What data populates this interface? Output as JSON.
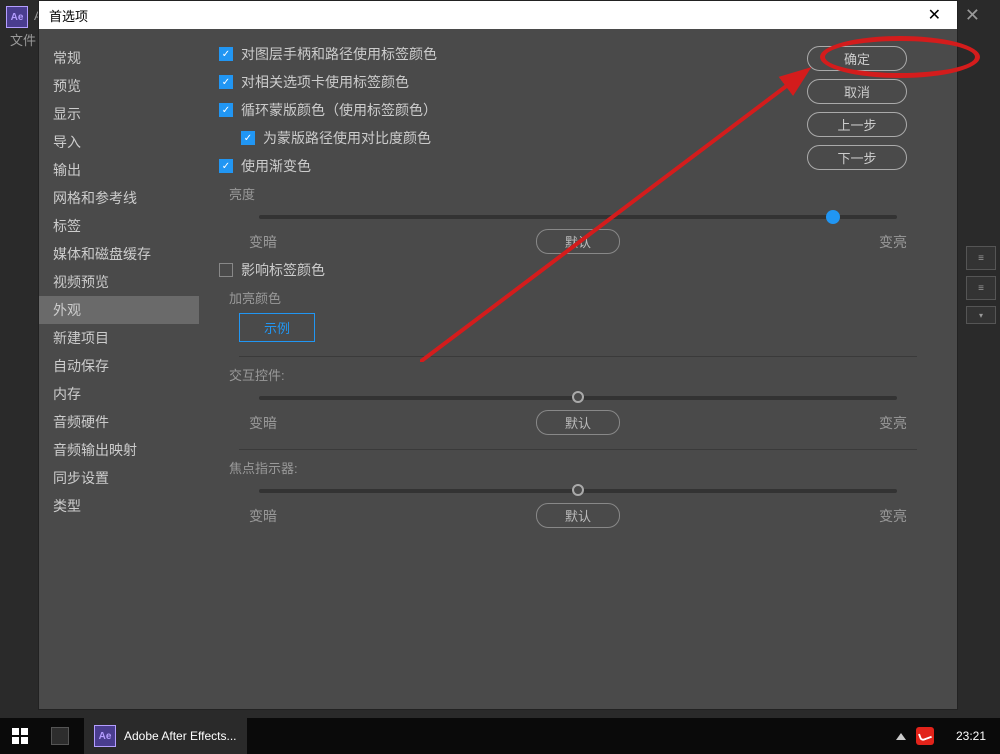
{
  "dialog": {
    "title": "首选项",
    "close": "✕"
  },
  "bg": {
    "menu_file": "文件",
    "close": "✕",
    "ae_label": "Ae",
    "ae_label_small": "A"
  },
  "sidebar": {
    "items": [
      {
        "label": "常规"
      },
      {
        "label": "预览"
      },
      {
        "label": "显示"
      },
      {
        "label": "导入"
      },
      {
        "label": "输出"
      },
      {
        "label": "网格和参考线"
      },
      {
        "label": "标签"
      },
      {
        "label": "媒体和磁盘缓存"
      },
      {
        "label": "视频预览"
      },
      {
        "label": "外观"
      },
      {
        "label": "新建项目"
      },
      {
        "label": "自动保存"
      },
      {
        "label": "内存"
      },
      {
        "label": "音频硬件"
      },
      {
        "label": "音频输出映射"
      },
      {
        "label": "同步设置"
      },
      {
        "label": "类型"
      }
    ],
    "active_index": 9
  },
  "content": {
    "checkbox_1": "对图层手柄和路径使用标签颜色",
    "checkbox_2": "对相关选项卡使用标签颜色",
    "checkbox_3": "循环蒙版颜色（使用标签颜色）",
    "checkbox_4": "为蒙版路径使用对比度颜色",
    "checkbox_5": "使用渐变色",
    "brightness_label": "亮度",
    "darker": "变暗",
    "lighter": "变亮",
    "default_btn": "默认",
    "affect_label_colors": "影响标签颜色",
    "highlight_color_label": "加亮颜色",
    "example_btn": "示例",
    "interactive_controls_label": "交互控件:",
    "focus_indicator_label": "焦点指示器:",
    "brightness_slider_value": 90,
    "interactive_slider_value": 50,
    "focus_slider_value": 50
  },
  "buttons": {
    "ok": "确定",
    "cancel": "取消",
    "prev": "上一步",
    "next": "下一步"
  },
  "taskbar": {
    "app_name": "Adobe After Effects...",
    "clock": "23:21"
  }
}
